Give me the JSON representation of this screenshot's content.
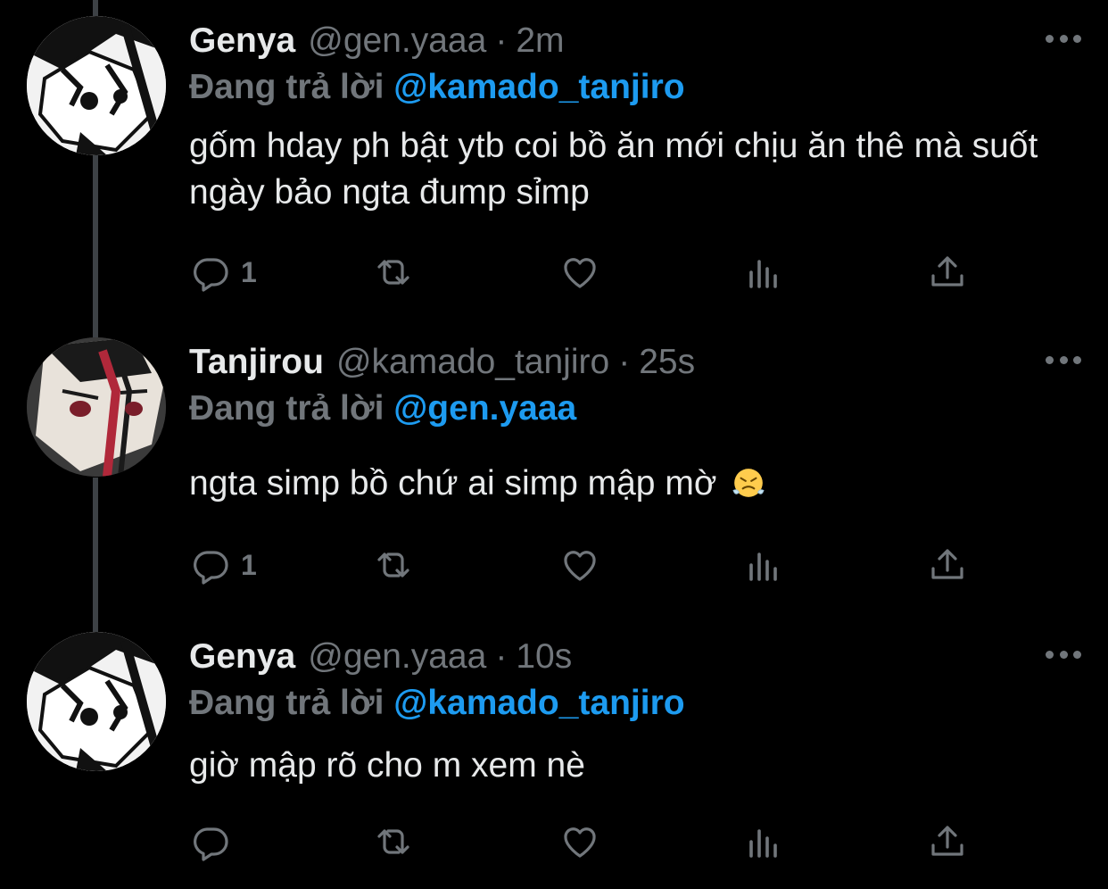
{
  "colors": {
    "background": "#000000",
    "text": "#e7e9ea",
    "muted": "#71767b",
    "link": "#1d9bf0",
    "thread_line": "#3d4145"
  },
  "icons": {
    "reply": "reply-icon",
    "retweet": "retweet-icon",
    "like": "heart-icon",
    "analytics": "analytics-icon",
    "share": "share-icon",
    "more": "more-icon",
    "emoji": "face-with-steam-from-nose-emoji"
  },
  "tweets": [
    {
      "name": "Genya",
      "handle": "@gen.yaaa",
      "separator": "·",
      "time": "2m",
      "reply_prefix": "Đang trả lời",
      "reply_to": "@kamado_tanjiro",
      "text": "gốm hday ph bật ytb coi bồ ăn mới chịu ăn thê mà suốt ngày bảo ngta đump sỉmp",
      "reply_count": "1"
    },
    {
      "name": "Tanjirou",
      "handle": "@kamado_tanjiro",
      "separator": "·",
      "time": "25s",
      "reply_prefix": "Đang trả lời",
      "reply_to": "@gen.yaaa",
      "text": "ngta simp bồ chứ ai simp mập mờ",
      "reply_count": "1"
    },
    {
      "name": "Genya",
      "handle": "@gen.yaaa",
      "separator": "·",
      "time": "10s",
      "reply_prefix": "Đang trả lời",
      "reply_to": "@kamado_tanjiro",
      "text": "giờ mập rõ cho m xem nè",
      "reply_count": ""
    }
  ]
}
